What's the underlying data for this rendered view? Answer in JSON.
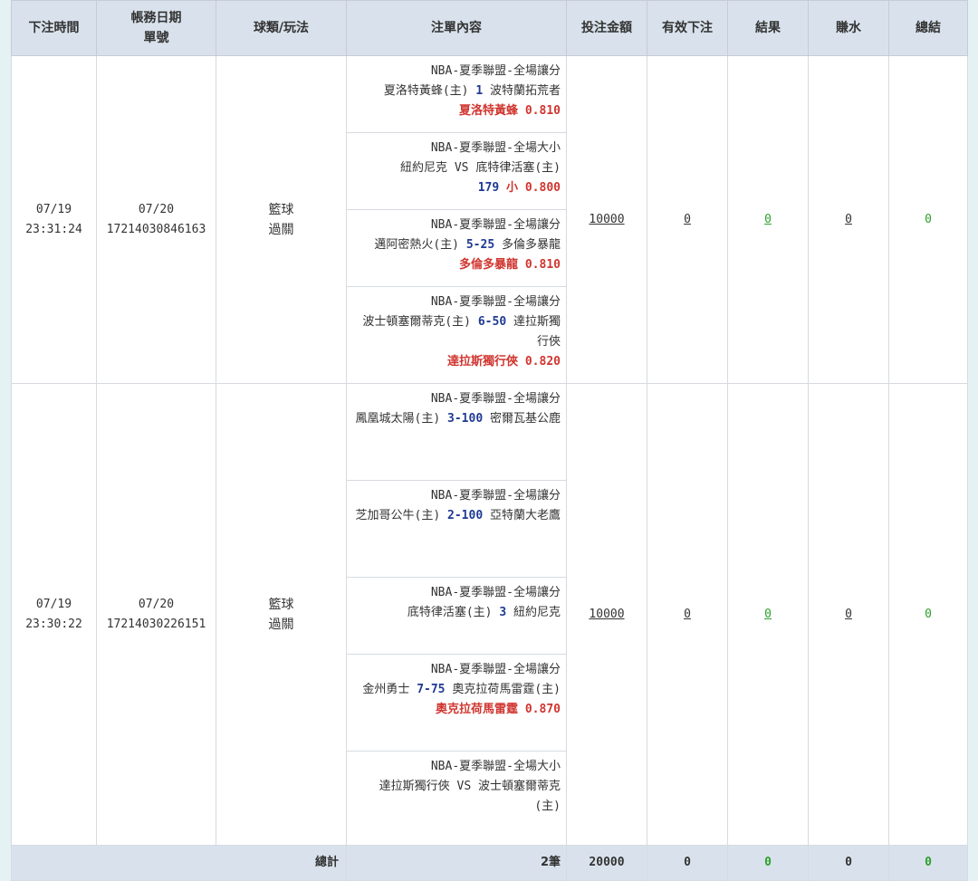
{
  "headers": [
    "下注時間",
    "帳務日期\n單號",
    "球類/玩法",
    "注單內容",
    "投注金額",
    "有效下注",
    "結果",
    "賺水",
    "總結"
  ],
  "rows": [
    {
      "time": "07/19\n23:31:24",
      "ticket": "07/20\n17214030846163",
      "sport": "籃球\n過關",
      "bets": [
        {
          "league": "NBA-夏季聯盟-全場讓分",
          "home": "夏洛特黃蜂(主)",
          "line": "1",
          "away": "波特蘭拓荒者",
          "pick": "夏洛特黃蜂",
          "odds": "0.810"
        },
        {
          "league": "NBA-夏季聯盟-全場大小",
          "home": "紐約尼克",
          "vs": "VS",
          "away": "底特律活塞(主)",
          "line": "179",
          "pick": "小",
          "odds": "0.800"
        },
        {
          "league": "NBA-夏季聯盟-全場讓分",
          "home": "邁阿密熱火(主)",
          "line": "5-25",
          "away": "多倫多暴龍",
          "pick": "多倫多暴龍",
          "odds": "0.810"
        },
        {
          "league": "NBA-夏季聯盟-全場讓分",
          "home": "波士頓塞爾蒂克(主)",
          "line": "6-50",
          "away": "達拉斯獨行俠",
          "pick": "達拉斯獨行俠",
          "odds": "0.820"
        }
      ],
      "amount": "10000",
      "valid": "0",
      "result": "0",
      "rebate": "0",
      "total": "0"
    },
    {
      "time": "07/19\n23:30:22",
      "ticket": "07/20\n17214030226151",
      "sport": "籃球\n過關",
      "bets": [
        {
          "league": "NBA-夏季聯盟-全場讓分",
          "home": "鳳凰城太陽(主)",
          "line": "3-100",
          "away": "密爾瓦基公鹿"
        },
        {
          "league": "NBA-夏季聯盟-全場讓分",
          "home": "芝加哥公牛(主)",
          "line": "2-100",
          "away": "亞特蘭大老鷹"
        },
        {
          "league": "NBA-夏季聯盟-全場讓分",
          "home": "底特律活塞(主)",
          "line": "3",
          "away": "紐約尼克"
        },
        {
          "league": "NBA-夏季聯盟-全場讓分",
          "home": "金州勇士",
          "line": "7-75",
          "away": "奧克拉荷馬雷霆(主)",
          "pick": "奧克拉荷馬雷霆",
          "odds": "0.870"
        },
        {
          "league": "NBA-夏季聯盟-全場大小",
          "home": "達拉斯獨行俠",
          "vs": "VS",
          "away": "波士頓塞爾蒂克(主)"
        }
      ],
      "amount": "10000",
      "valid": "0",
      "result": "0",
      "rebate": "0",
      "total": "0"
    }
  ],
  "summary": {
    "label": "總計",
    "count": "2筆",
    "amount": "20000",
    "valid": "0",
    "result": "0",
    "rebate": "0",
    "total": "0"
  }
}
